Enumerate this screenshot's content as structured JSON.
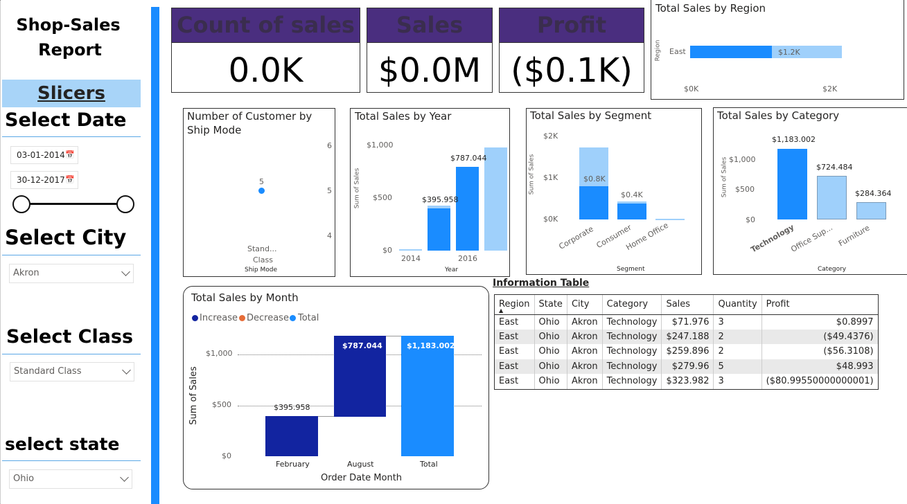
{
  "sidebar": {
    "title_line1": "Shop-Sales",
    "title_line2": "Report",
    "slicers_label": "Slicers",
    "select_date": "Select Date",
    "date_start": "03-01-2014",
    "date_end": "30-12-2017",
    "select_city": "Select City",
    "city_value": "Akron",
    "select_class": "Select Class",
    "class_value": "Standard Class",
    "select_state": "select state",
    "state_value": "Ohio"
  },
  "cards": [
    {
      "label": "Count of sales",
      "value": "0.0K"
    },
    {
      "label": "Sales",
      "value": "$0.0M"
    },
    {
      "label": "Profit",
      "value": "($0.1K)"
    }
  ],
  "region_chart": {
    "title": "Total Sales by Region",
    "ylabel": "Region",
    "category": "East",
    "label": "$1.2K",
    "ticks": [
      "$0K",
      "$2K"
    ]
  },
  "shipmode_chart": {
    "title_line1": "Number of Customer by",
    "title_line2": "Ship Mode",
    "point_label": "5",
    "ticks": [
      "6",
      "5",
      "4"
    ],
    "category_line1": "Stand...",
    "category_line2": "Class",
    "xlabel": "Ship Mode"
  },
  "year_chart": {
    "title": "Total Sales by Year",
    "ylabel": "Sum of Sales",
    "xlabel": "Year",
    "yticks": [
      "$1,000",
      "$500",
      "$0"
    ],
    "xticks": [
      "2014",
      "2016"
    ],
    "labels": [
      "$395.958",
      "$787.044"
    ]
  },
  "segment_chart": {
    "title": "Total Sales by Segment",
    "ylabel": "Sum of Sales",
    "xlabel": "Segment",
    "yticks": [
      "$2K",
      "$1K",
      "$0K"
    ],
    "categories": [
      "Corporate",
      "Consumer",
      "Home Office"
    ],
    "labels": [
      "$0.8K",
      "$0.4K"
    ]
  },
  "category_chart": {
    "title": "Total Sales by Category",
    "ylabel": "Sum of Sales",
    "xlabel": "Category",
    "yticks": [
      "$1,000",
      "$500",
      "$0"
    ],
    "categories": [
      "Technology",
      "Office Sup...",
      "Furniture"
    ],
    "labels": [
      "$1,183.002",
      "$724.484",
      "$284.364"
    ]
  },
  "month_chart": {
    "title": "Total Sales by Month",
    "legend": [
      "Increase",
      "Decrease",
      "Total"
    ],
    "ylabel": "Sum of Sales",
    "xlabel": "Order Date Month",
    "yticks": [
      "$1,000",
      "$500",
      "$0"
    ],
    "categories": [
      "February",
      "August",
      "Total"
    ],
    "labels": [
      "$395.958",
      "$787.044",
      "$1,183.002"
    ]
  },
  "info_table": {
    "title": "Information Table",
    "columns": [
      "Region",
      "State",
      "City",
      "Category",
      "Sales",
      "Quantity",
      "Profit"
    ],
    "rows": [
      [
        "East",
        "Ohio",
        "Akron",
        "Technology",
        "$71.976",
        "3",
        "$0.8997"
      ],
      [
        "East",
        "Ohio",
        "Akron",
        "Technology",
        "$247.188",
        "2",
        "($49.4376)"
      ],
      [
        "East",
        "Ohio",
        "Akron",
        "Technology",
        "$259.896",
        "2",
        "($56.3108)"
      ],
      [
        "East",
        "Ohio",
        "Akron",
        "Technology",
        "$279.96",
        "5",
        "$48.993"
      ],
      [
        "East",
        "Ohio",
        "Akron",
        "Technology",
        "$323.982",
        "3",
        "($80.99550000000001)"
      ]
    ]
  },
  "colors": {
    "accent": "#1a8cff",
    "light": "#9fd0fb",
    "dark": "#1224a0",
    "card_header": "#4a2e7f",
    "decrease": "#e66c37"
  }
}
